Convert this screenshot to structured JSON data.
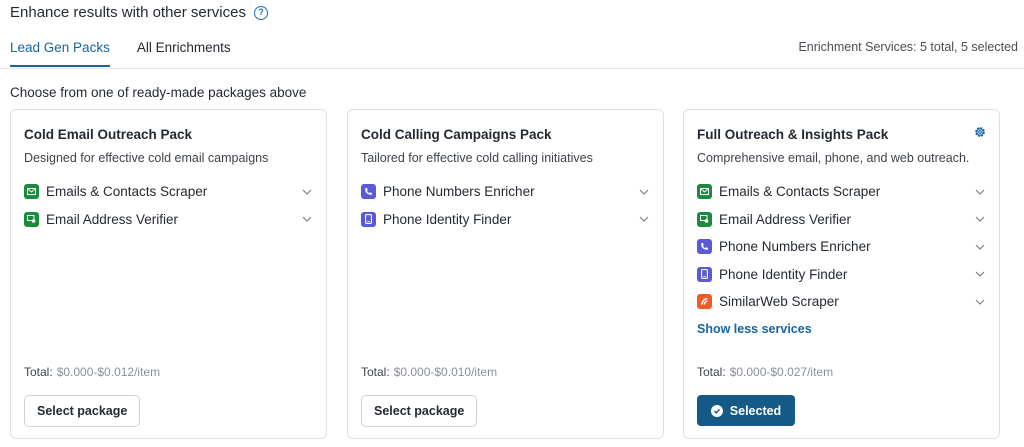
{
  "header": {
    "title": "Enhance results with other services",
    "help_icon": "question-circle-icon"
  },
  "tabs": [
    {
      "label": "Lead Gen Packs",
      "active": true
    },
    {
      "label": "All Enrichments",
      "active": false
    }
  ],
  "summary": "Enrichment Services: 5 total, 5 selected",
  "subtitle": "Choose from one of ready-made packages above",
  "colors": {
    "accent": "#1665a3",
    "selected_button": "#155a87",
    "email_icon": "#1e8a3e",
    "phone_icon": "#5b5bd6",
    "similarweb_icon": "#f05a28"
  },
  "cards": [
    {
      "title": "Cold Email Outreach Pack",
      "description": "Designed for effective cold email campaigns",
      "services": [
        {
          "label": "Emails & Contacts Scraper",
          "icon": "envelope-icon"
        },
        {
          "label": "Email Address Verifier",
          "icon": "verified-email-icon"
        }
      ],
      "total_label": "Total:",
      "total_value": "$0.000-$0.012/item",
      "button_label": "Select package"
    },
    {
      "title": "Cold Calling Campaigns Pack",
      "description": "Tailored for effective cold calling initiatives",
      "services": [
        {
          "label": "Phone Numbers Enricher",
          "icon": "phone-icon"
        },
        {
          "label": "Phone Identity Finder",
          "icon": "mobile-phone-icon"
        }
      ],
      "total_label": "Total:",
      "total_value": "$0.000-$0.010/item",
      "button_label": "Select package"
    },
    {
      "title": "Full Outreach & Insights Pack",
      "description": "Comprehensive email, phone, and web outreach.",
      "services": [
        {
          "label": "Emails & Contacts Scraper",
          "icon": "envelope-icon"
        },
        {
          "label": "Email Address Verifier",
          "icon": "verified-email-icon"
        },
        {
          "label": "Phone Numbers Enricher",
          "icon": "phone-icon"
        },
        {
          "label": "Phone Identity Finder",
          "icon": "mobile-phone-icon"
        },
        {
          "label": "SimilarWeb Scraper",
          "icon": "similarweb-icon"
        }
      ],
      "show_less_label": "Show less services",
      "total_label": "Total:",
      "total_value": "$0.000-$0.027/item",
      "button_label": "Selected",
      "settings_icon": "gear-icon"
    }
  ]
}
